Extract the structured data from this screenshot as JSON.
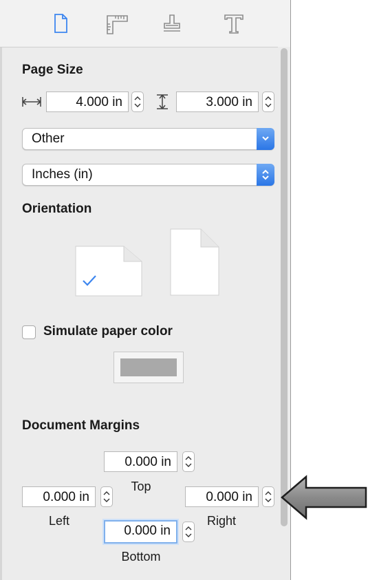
{
  "page_size": {
    "heading": "Page Size",
    "width_value": "4.000 in",
    "height_value": "3.000 in",
    "paper_popup": "Other",
    "units_popup": "Inches (in)"
  },
  "orientation": {
    "heading": "Orientation",
    "selected": "landscape"
  },
  "simulate": {
    "label": "Simulate paper color",
    "checked": false,
    "paper_color": "#a9a9a9"
  },
  "margins": {
    "heading": "Document Margins",
    "top_value": "0.000 in",
    "top_label": "Top",
    "left_value": "0.000 in",
    "left_label": "Left",
    "right_value": "0.000 in",
    "right_label": "Right",
    "bottom_value": "0.000 in",
    "bottom_label": "Bottom"
  },
  "tabs": [
    "document-icon",
    "ruler-icon",
    "stamp-icon",
    "text-icon"
  ],
  "colors": {
    "accent": "#3d86ef",
    "arrow": "#8a8a8a"
  }
}
